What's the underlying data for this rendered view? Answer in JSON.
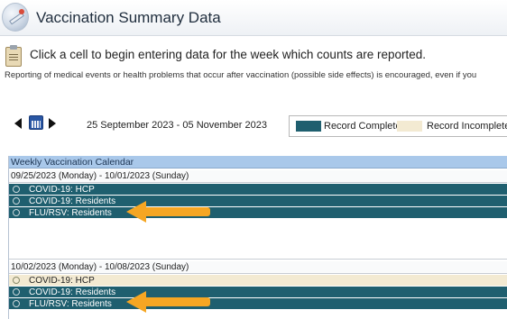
{
  "window": {
    "title": "Vaccination Summary Data"
  },
  "instructions": {
    "main": "Click a cell to begin entering data for the week which counts are reported.",
    "sub": "Reporting of medical events or health problems that occur after vaccination (possible side effects) is encouraged, even if you"
  },
  "navigation": {
    "date_range": "25 September 2023  -  05 November 2023"
  },
  "legend": {
    "complete_label": "Record Complete",
    "complete_color": "#1f5f6f",
    "incomplete_label": "Record Incomplete",
    "incomplete_color": "#f3ead2"
  },
  "calendar": {
    "header": "Weekly Vaccination Calendar",
    "weeks": [
      {
        "date_label": "09/25/2023 (Monday) - 10/01/2023 (Sunday)",
        "records": [
          {
            "label": "COVID-19: HCP",
            "status": "complete"
          },
          {
            "label": "COVID-19: Residents",
            "status": "complete"
          },
          {
            "label": "FLU/RSV: Residents",
            "status": "complete"
          }
        ]
      },
      {
        "date_label": "10/02/2023 (Monday) - 10/08/2023 (Sunday)",
        "records": [
          {
            "label": "COVID-19: HCP",
            "status": "incomplete"
          },
          {
            "label": "COVID-19: Residents",
            "status": "complete"
          },
          {
            "label": "FLU/RSV: Residents",
            "status": "complete"
          }
        ]
      }
    ]
  },
  "annotations": {
    "arrow_color": "#f5a623"
  }
}
